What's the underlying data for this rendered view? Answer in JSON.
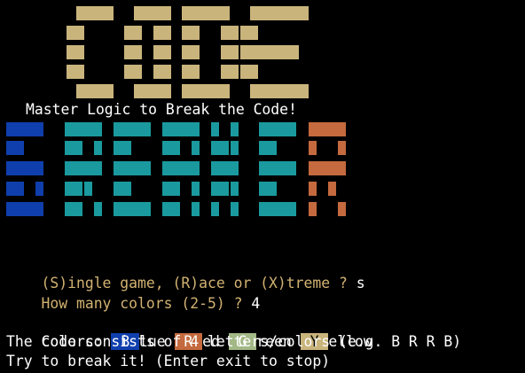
{
  "palette": {
    "background": "#000000",
    "code_block": "#c9b47c",
    "blue": "#0f3fad",
    "teal": "#1a9a9e",
    "red_orange": "#c46a3e",
    "green": "#a2b886",
    "yellow": "#c9b47c",
    "prompt_text": "#d2b272",
    "white_text": "#ffffff"
  },
  "banner": {
    "title_word": "CODE",
    "subtitle_word": "BREAKER",
    "tagline": "Master Logic to Break the Code!"
  },
  "prompts": {
    "mode_question": "(S)ingle game, (R)ace or (X)treme ? ",
    "mode_answer": "s",
    "colors_question": "How many colors (2-5) ? ",
    "colors_answer": "4"
  },
  "colors_line": {
    "label": "Colors: ",
    "items": [
      {
        "letter": "B",
        "rest": "lue",
        "color": "#0f3fad",
        "letter_color": "#ffffff"
      },
      {
        "letter": "R",
        "rest": "ed",
        "color": "#c46a3e",
        "letter_color": "#ffffff"
      },
      {
        "letter": "G",
        "rest": "reen",
        "color": "#a2b886",
        "letter_color": "#ffffff"
      },
      {
        "letter": "Y",
        "rest": "ellow",
        "color": "#c9b47c",
        "letter_color": "#000000"
      }
    ]
  },
  "info_lines": {
    "code_info": "The code consists of 4 letters/colors (e.g. B R R B)",
    "instruction": "Try to break it! (Enter exit to stop)"
  }
}
